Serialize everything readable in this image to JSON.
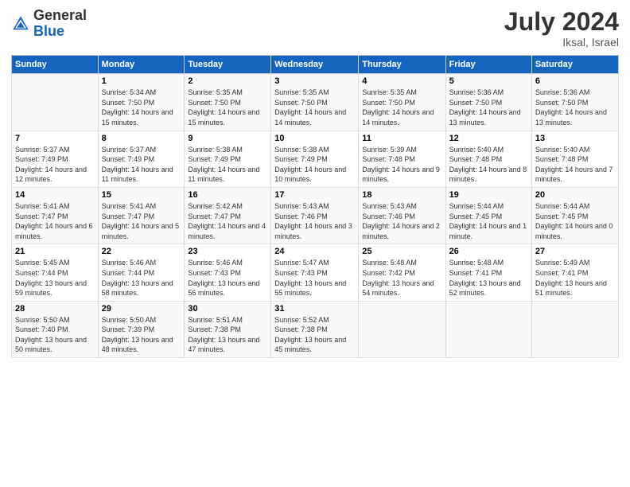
{
  "header": {
    "logo_general": "General",
    "logo_blue": "Blue",
    "month_title": "July 2024",
    "subtitle": "Iksal, Israel"
  },
  "days_of_week": [
    "Sunday",
    "Monday",
    "Tuesday",
    "Wednesday",
    "Thursday",
    "Friday",
    "Saturday"
  ],
  "weeks": [
    [
      {
        "day": "",
        "sunrise": "",
        "sunset": "",
        "daylight": ""
      },
      {
        "day": "1",
        "sunrise": "Sunrise: 5:34 AM",
        "sunset": "Sunset: 7:50 PM",
        "daylight": "Daylight: 14 hours and 15 minutes."
      },
      {
        "day": "2",
        "sunrise": "Sunrise: 5:35 AM",
        "sunset": "Sunset: 7:50 PM",
        "daylight": "Daylight: 14 hours and 15 minutes."
      },
      {
        "day": "3",
        "sunrise": "Sunrise: 5:35 AM",
        "sunset": "Sunset: 7:50 PM",
        "daylight": "Daylight: 14 hours and 14 minutes."
      },
      {
        "day": "4",
        "sunrise": "Sunrise: 5:35 AM",
        "sunset": "Sunset: 7:50 PM",
        "daylight": "Daylight: 14 hours and 14 minutes."
      },
      {
        "day": "5",
        "sunrise": "Sunrise: 5:36 AM",
        "sunset": "Sunset: 7:50 PM",
        "daylight": "Daylight: 14 hours and 13 minutes."
      },
      {
        "day": "6",
        "sunrise": "Sunrise: 5:36 AM",
        "sunset": "Sunset: 7:50 PM",
        "daylight": "Daylight: 14 hours and 13 minutes."
      }
    ],
    [
      {
        "day": "7",
        "sunrise": "Sunrise: 5:37 AM",
        "sunset": "Sunset: 7:49 PM",
        "daylight": "Daylight: 14 hours and 12 minutes."
      },
      {
        "day": "8",
        "sunrise": "Sunrise: 5:37 AM",
        "sunset": "Sunset: 7:49 PM",
        "daylight": "Daylight: 14 hours and 11 minutes."
      },
      {
        "day": "9",
        "sunrise": "Sunrise: 5:38 AM",
        "sunset": "Sunset: 7:49 PM",
        "daylight": "Daylight: 14 hours and 11 minutes."
      },
      {
        "day": "10",
        "sunrise": "Sunrise: 5:38 AM",
        "sunset": "Sunset: 7:49 PM",
        "daylight": "Daylight: 14 hours and 10 minutes."
      },
      {
        "day": "11",
        "sunrise": "Sunrise: 5:39 AM",
        "sunset": "Sunset: 7:48 PM",
        "daylight": "Daylight: 14 hours and 9 minutes."
      },
      {
        "day": "12",
        "sunrise": "Sunrise: 5:40 AM",
        "sunset": "Sunset: 7:48 PM",
        "daylight": "Daylight: 14 hours and 8 minutes."
      },
      {
        "day": "13",
        "sunrise": "Sunrise: 5:40 AM",
        "sunset": "Sunset: 7:48 PM",
        "daylight": "Daylight: 14 hours and 7 minutes."
      }
    ],
    [
      {
        "day": "14",
        "sunrise": "Sunrise: 5:41 AM",
        "sunset": "Sunset: 7:47 PM",
        "daylight": "Daylight: 14 hours and 6 minutes."
      },
      {
        "day": "15",
        "sunrise": "Sunrise: 5:41 AM",
        "sunset": "Sunset: 7:47 PM",
        "daylight": "Daylight: 14 hours and 5 minutes."
      },
      {
        "day": "16",
        "sunrise": "Sunrise: 5:42 AM",
        "sunset": "Sunset: 7:47 PM",
        "daylight": "Daylight: 14 hours and 4 minutes."
      },
      {
        "day": "17",
        "sunrise": "Sunrise: 5:43 AM",
        "sunset": "Sunset: 7:46 PM",
        "daylight": "Daylight: 14 hours and 3 minutes."
      },
      {
        "day": "18",
        "sunrise": "Sunrise: 5:43 AM",
        "sunset": "Sunset: 7:46 PM",
        "daylight": "Daylight: 14 hours and 2 minutes."
      },
      {
        "day": "19",
        "sunrise": "Sunrise: 5:44 AM",
        "sunset": "Sunset: 7:45 PM",
        "daylight": "Daylight: 14 hours and 1 minute."
      },
      {
        "day": "20",
        "sunrise": "Sunrise: 5:44 AM",
        "sunset": "Sunset: 7:45 PM",
        "daylight": "Daylight: 14 hours and 0 minutes."
      }
    ],
    [
      {
        "day": "21",
        "sunrise": "Sunrise: 5:45 AM",
        "sunset": "Sunset: 7:44 PM",
        "daylight": "Daylight: 13 hours and 59 minutes."
      },
      {
        "day": "22",
        "sunrise": "Sunrise: 5:46 AM",
        "sunset": "Sunset: 7:44 PM",
        "daylight": "Daylight: 13 hours and 58 minutes."
      },
      {
        "day": "23",
        "sunrise": "Sunrise: 5:46 AM",
        "sunset": "Sunset: 7:43 PM",
        "daylight": "Daylight: 13 hours and 56 minutes."
      },
      {
        "day": "24",
        "sunrise": "Sunrise: 5:47 AM",
        "sunset": "Sunset: 7:43 PM",
        "daylight": "Daylight: 13 hours and 55 minutes."
      },
      {
        "day": "25",
        "sunrise": "Sunrise: 5:48 AM",
        "sunset": "Sunset: 7:42 PM",
        "daylight": "Daylight: 13 hours and 54 minutes."
      },
      {
        "day": "26",
        "sunrise": "Sunrise: 5:48 AM",
        "sunset": "Sunset: 7:41 PM",
        "daylight": "Daylight: 13 hours and 52 minutes."
      },
      {
        "day": "27",
        "sunrise": "Sunrise: 5:49 AM",
        "sunset": "Sunset: 7:41 PM",
        "daylight": "Daylight: 13 hours and 51 minutes."
      }
    ],
    [
      {
        "day": "28",
        "sunrise": "Sunrise: 5:50 AM",
        "sunset": "Sunset: 7:40 PM",
        "daylight": "Daylight: 13 hours and 50 minutes."
      },
      {
        "day": "29",
        "sunrise": "Sunrise: 5:50 AM",
        "sunset": "Sunset: 7:39 PM",
        "daylight": "Daylight: 13 hours and 48 minutes."
      },
      {
        "day": "30",
        "sunrise": "Sunrise: 5:51 AM",
        "sunset": "Sunset: 7:38 PM",
        "daylight": "Daylight: 13 hours and 47 minutes."
      },
      {
        "day": "31",
        "sunrise": "Sunrise: 5:52 AM",
        "sunset": "Sunset: 7:38 PM",
        "daylight": "Daylight: 13 hours and 45 minutes."
      },
      {
        "day": "",
        "sunrise": "",
        "sunset": "",
        "daylight": ""
      },
      {
        "day": "",
        "sunrise": "",
        "sunset": "",
        "daylight": ""
      },
      {
        "day": "",
        "sunrise": "",
        "sunset": "",
        "daylight": ""
      }
    ]
  ]
}
